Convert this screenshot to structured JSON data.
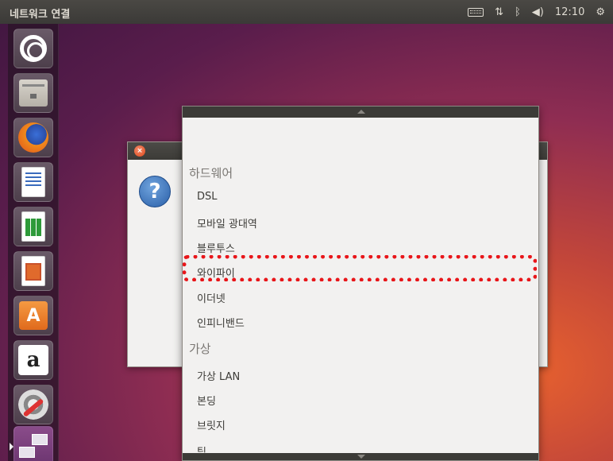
{
  "top_panel": {
    "title": "네트워크 연결",
    "clock": "12:10",
    "icons": [
      "keyboard-icon",
      "network-arrows-icon",
      "bluetooth-icon",
      "volume-icon",
      "gear-icon"
    ]
  },
  "launcher": {
    "items": [
      {
        "name": "ubuntu-dash",
        "icon": "ubuntu-logo-icon"
      },
      {
        "name": "files",
        "icon": "files-icon"
      },
      {
        "name": "firefox",
        "icon": "firefox-icon"
      },
      {
        "name": "libreoffice-writer",
        "icon": "writer-icon"
      },
      {
        "name": "libreoffice-calc",
        "icon": "calc-icon"
      },
      {
        "name": "libreoffice-impress",
        "icon": "impress-icon"
      },
      {
        "name": "software-center",
        "icon": "store-icon",
        "glyph": "A"
      },
      {
        "name": "amazon",
        "icon": "amazon-icon",
        "glyph": "a"
      },
      {
        "name": "system-settings",
        "icon": "settings-icon"
      },
      {
        "name": "network-connections",
        "icon": "network-icon"
      }
    ]
  },
  "dialog": {
    "close_glyph": "×",
    "question_glyph": "?"
  },
  "dropdown": {
    "hardware_header": "하드웨어",
    "hardware_items": [
      "DSL",
      "모바일 광대역",
      "블루투스",
      "와이파이",
      "이더넷",
      "인피니밴드"
    ],
    "virtual_header": "가상",
    "virtual_items": [
      "가상 LAN",
      "본딩",
      "브릿지",
      "팀"
    ],
    "highlighted_item": "와이파이",
    "highlight_color": "#e8161a"
  }
}
